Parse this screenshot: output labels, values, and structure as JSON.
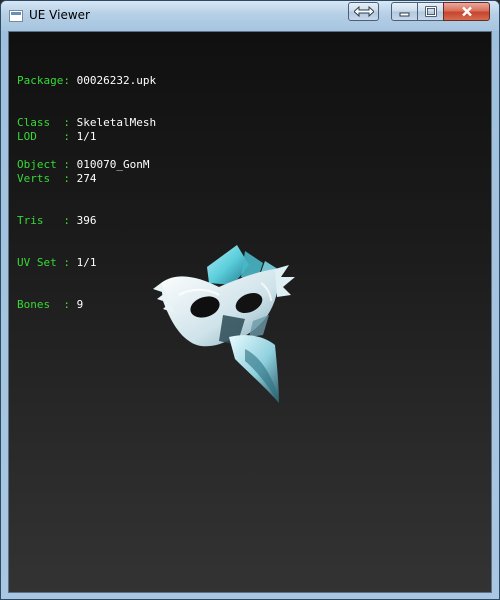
{
  "window": {
    "title": "UE Viewer"
  },
  "icons": {
    "app": "app-window-icon",
    "fullscreen": "fullscreen-arrows-icon",
    "minimize": "minimize-icon",
    "maximize": "maximize-icon",
    "close": "close-icon"
  },
  "colors": {
    "label": "#36d936",
    "value": "#ffffff",
    "mesh_accent": "#5fd8e6"
  },
  "info": {
    "package_label": "Package:",
    "package_value": "00026232.upk",
    "class_label": "Class  :",
    "class_value": "SkeletalMesh",
    "object_label": "Object :",
    "object_value": "010070_GonM",
    "lod_label": "LOD    :",
    "lod_value": "1/1",
    "verts_label": "Verts  :",
    "verts_value": "274",
    "tris_label": "Tris   :",
    "tris_value": "396",
    "uvset_label": "UV Set :",
    "uvset_value": "1/1",
    "bones_label": "Bones  :",
    "bones_value": "9"
  }
}
